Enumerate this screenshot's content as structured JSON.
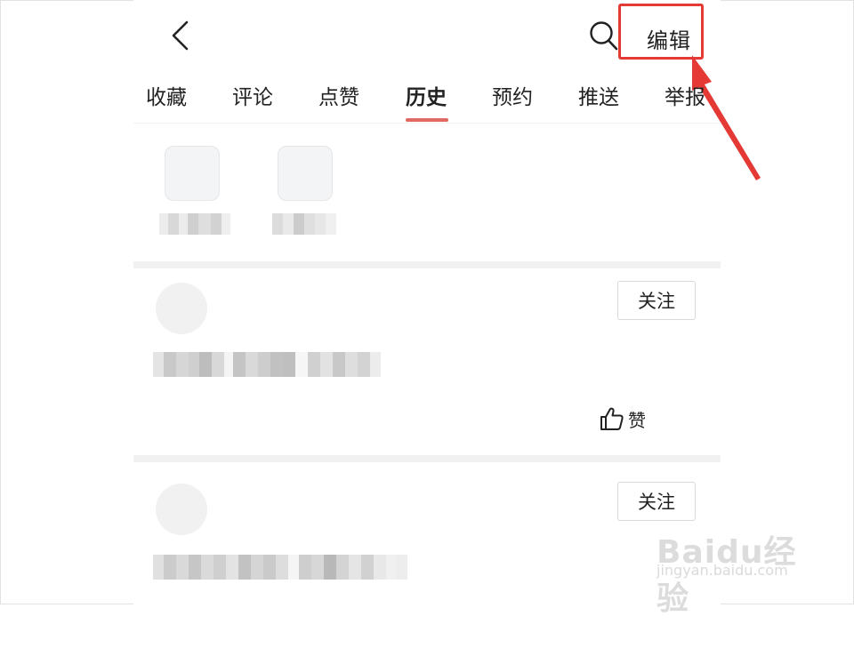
{
  "header": {
    "back_icon": "chevron-left-icon",
    "search_icon": "search-icon",
    "edit_label": "编辑"
  },
  "annotation": {
    "color": "#e53935"
  },
  "tabs": [
    {
      "label": "收藏",
      "active": false
    },
    {
      "label": "评论",
      "active": false
    },
    {
      "label": "点赞",
      "active": false
    },
    {
      "label": "历史",
      "active": true
    },
    {
      "label": "预约",
      "active": false
    },
    {
      "label": "推送",
      "active": false
    },
    {
      "label": "举报",
      "active": false
    }
  ],
  "accent_color": "#e06a62",
  "feed": [
    {
      "follow_label": "关注",
      "like_label": "赞",
      "like_icon": "thumbs-up-icon"
    },
    {
      "follow_label": "关注"
    }
  ],
  "watermark": {
    "brand": "Baidu经验",
    "url": "jingyan.baidu.com"
  }
}
